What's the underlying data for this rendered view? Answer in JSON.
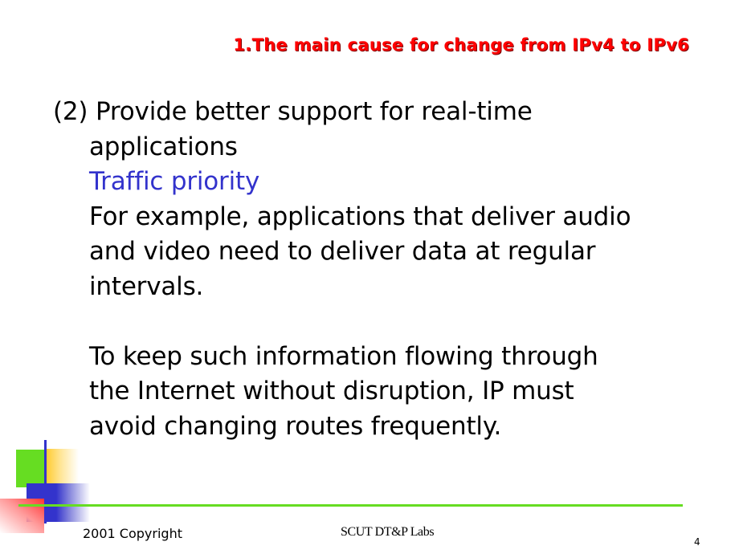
{
  "slide": {
    "title": "1.The main cause for change from IPv4 to IPv6",
    "body": {
      "heading_line_1": "(2) Provide better support for real-time",
      "heading_line_2": "applications",
      "subheading": "Traffic priority",
      "paragraph_1": [
        "For example, applications that deliver audio",
        "and video need to deliver data at regular",
        "intervals."
      ],
      "paragraph_2": [
        "To keep such information flowing through",
        "the Internet without disruption, IP must",
        "avoid changing routes frequently."
      ]
    },
    "colors": {
      "title": "#ff0000",
      "subheading": "#3333cc",
      "accent_green": "#66dd22",
      "accent_blue": "#3333cc",
      "accent_yellow": "#ffcc33",
      "accent_red": "#ff3333"
    }
  },
  "footer": {
    "copyright": "2001 Copyright",
    "organization": "SCUT DT&P Labs",
    "page_number": "4"
  }
}
